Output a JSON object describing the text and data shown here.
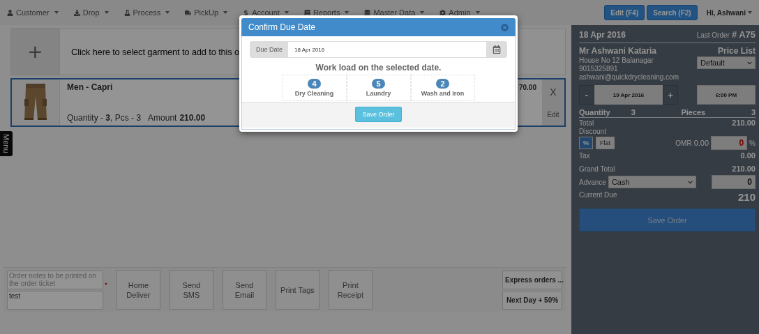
{
  "nav": {
    "items": [
      {
        "label": "Customer"
      },
      {
        "label": "Drop"
      },
      {
        "label": "Process"
      },
      {
        "label": "PickUp"
      },
      {
        "label": "Account"
      },
      {
        "label": "Reports"
      },
      {
        "label": "Master Data"
      },
      {
        "label": "Admin"
      }
    ],
    "buttons": [
      "Edit (F4)",
      "Search (F2)"
    ],
    "user": "Hi,  Ashwani"
  },
  "add_garment": {
    "icon_text": "+",
    "label": "Click here to select garment to add to this o"
  },
  "items": [
    {
      "name": "Men - Capri",
      "summary": "Quantity - **3**, Pcs - 3",
      "amount_label": "Amount",
      "amount": "210.00",
      "price": "70.00",
      "remove": "X",
      "edit": "Edit"
    }
  ],
  "side_tab": "Menu",
  "bottom": {
    "notes_placeholder": "Order notes to be printed on the order ticket",
    "notes_value": "test",
    "required_mark": "*",
    "actions": [
      "Home Deliver",
      "Send SMS",
      "Send Email",
      "Print Tags",
      "Print Receipt"
    ],
    "express": [
      "Express orders ...",
      "Next Day + 50%"
    ]
  },
  "order_panel": {
    "date": "18 Apr 2016",
    "last_order_label": "Last Order",
    "hash": "#",
    "last_order": "A75",
    "customer": {
      "name": "Mr Ashwani Kataria",
      "address": "House No 12 Balanagar",
      "phone": "9015325891",
      "email": "ashwani@quickdrycleaning.com"
    },
    "price_list_label": "Price List",
    "price_list": "Default",
    "due": {
      "minus": "-",
      "date": "19 Apr 2016",
      "plus": "+",
      "time": "6:00 PM"
    },
    "quantity_label": "Quantity",
    "quantity": "3",
    "pieces_label": "Pieces",
    "pieces": "3",
    "total_label": "Total",
    "total": "210.00",
    "discount_label": "Discount",
    "discount_modes": [
      {
        "label": "%",
        "selected": true
      },
      {
        "label": "Flat",
        "selected": false
      }
    ],
    "currency": "OMR",
    "discount_amount": "0.00",
    "discount_value": "0",
    "percent": "%",
    "tax_label": "Tax",
    "tax": "0.00",
    "grand_total_label": "Grand Total",
    "grand_total": "210.00",
    "advance_label": "Advance",
    "advance_method": "Cash",
    "advance_value": "0",
    "current_due_label": "Current Due",
    "current_due": "210",
    "save": "Save Order"
  },
  "modal": {
    "title": "Confirm Due Date",
    "due_date_label": "Due Date",
    "due_date": "18 Apr 2016",
    "heading": "Work load on the selected date.",
    "workload": [
      {
        "count": "4",
        "label": "Dry Cleaning"
      },
      {
        "count": "5",
        "label": "Laundry"
      },
      {
        "count": "2",
        "label": "Wash and Iron"
      }
    ],
    "save": "Save Order"
  }
}
